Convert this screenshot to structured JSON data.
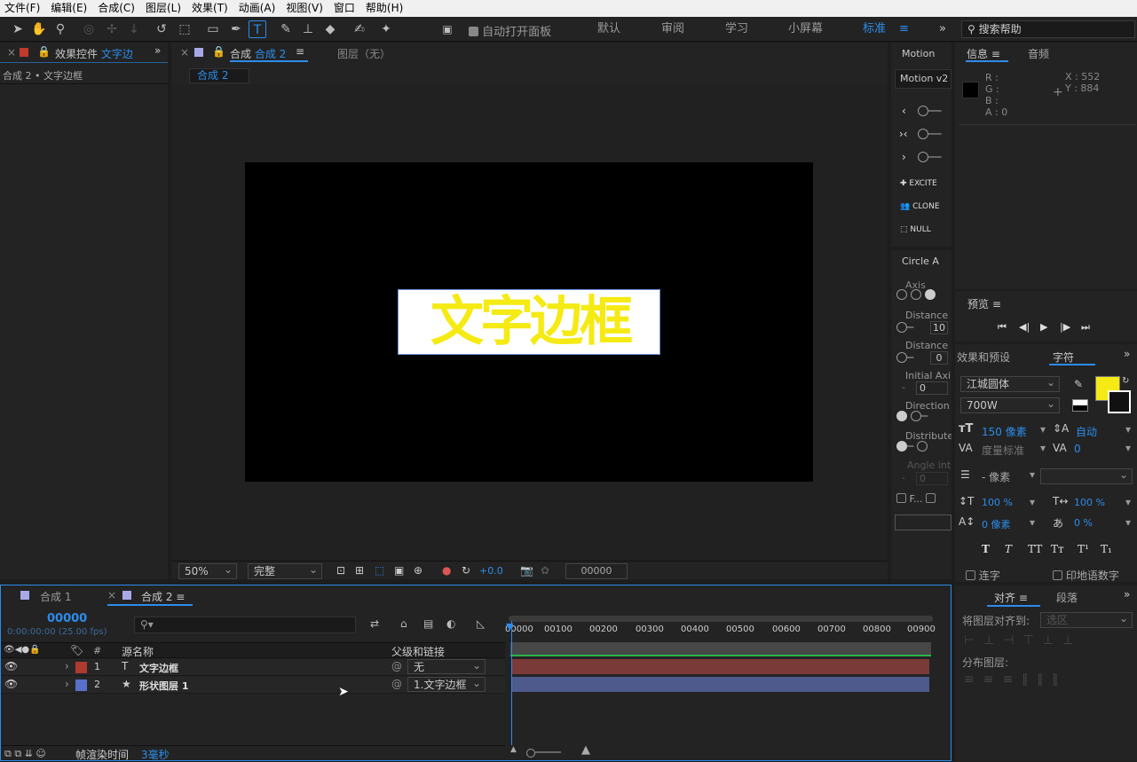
{
  "menu": [
    "文件(F)",
    "编辑(E)",
    "合成(C)",
    "图层(L)",
    "效果(T)",
    "动画(A)",
    "视图(V)",
    "窗口",
    "帮助(H)"
  ],
  "toolbar": {
    "auto_open_label": "自动打开面板",
    "workspaces": [
      "默认",
      "审阅",
      "学习",
      "小屏幕",
      "标准"
    ],
    "active_workspace": "标准",
    "search_placeholder": "搜索帮助"
  },
  "effects_panel": {
    "tab_prefix": "效果控件",
    "tab_layer": "文字边",
    "breadcrumb": "合成 2 • 文字边框"
  },
  "comp_panel": {
    "tab_prefix": "合成",
    "tab_name": "合成 2",
    "layer_tab": "图层（无）",
    "sub_tab": "合成 2",
    "preview_text": "文字边框",
    "text_color": "#f5ea14",
    "zoom": "50%",
    "quality": "完整",
    "exposure": "+0.0",
    "timecode": "00000"
  },
  "motion": {
    "title": "Motion",
    "tab": "Motion v2",
    "buttons": [
      "EXCITE",
      "CLONE",
      "NULL"
    ]
  },
  "circle": {
    "title": "Circle A",
    "labels": [
      "Axis",
      "Distance",
      "Distance",
      "Initial Axi",
      "Direction",
      "Distribute",
      "Angle int"
    ],
    "values": [
      "10",
      "0",
      "0",
      "0"
    ],
    "f_label": "F..."
  },
  "info": {
    "tab": "信息",
    "tab2": "音频",
    "r": "R :",
    "g": "G :",
    "b": "B :",
    "a": "A : 0",
    "x": "X : 552",
    "y": "Y : 884"
  },
  "preview": {
    "title": "预览"
  },
  "character": {
    "tab1": "效果和预设",
    "tab2": "字符",
    "font": "江城圆体",
    "weight": "700W",
    "fill_color": "#f5ea14",
    "size": "150 像素",
    "leading": "自动",
    "kerning": "度量标准",
    "tracking": "0",
    "stroke": "- 像素",
    "vscale": "100 %",
    "hscale": "100 %",
    "baseline": "0 像素",
    "tsume": "0 %",
    "ligature_label": "连字",
    "hindi_label": "印地语数字",
    "styles": [
      "T",
      "T",
      "TT",
      "Tт",
      "T¹",
      "T₁"
    ]
  },
  "align": {
    "tab1": "对齐",
    "tab2": "段落",
    "align_to": "将图层对齐到:",
    "align_target": "选区",
    "distribute": "分布图层:"
  },
  "timeline": {
    "tabs": [
      "合成 1",
      "合成 2"
    ],
    "timecode": "00000",
    "timecode_sub": "0:00:00:00 (25.00 fps)",
    "col_num": "#",
    "col_name": "源名称",
    "col_parent": "父级和链接",
    "ruler": [
      "00000",
      "00100",
      "00200",
      "00300",
      "00400",
      "00500",
      "00600",
      "00700",
      "00800",
      "00900"
    ],
    "layers": [
      {
        "num": "1",
        "type": "T",
        "name": "文字边框",
        "parent": "无",
        "color": "#b03a30",
        "bar": "#7a3a38"
      },
      {
        "num": "2",
        "type": "★",
        "name": "形状图层 1",
        "parent": "1.文字边框",
        "color": "#5870c8",
        "bar": "#4e5a8c"
      }
    ],
    "render_label": "帧渲染时间",
    "render_value": "3毫秒"
  }
}
